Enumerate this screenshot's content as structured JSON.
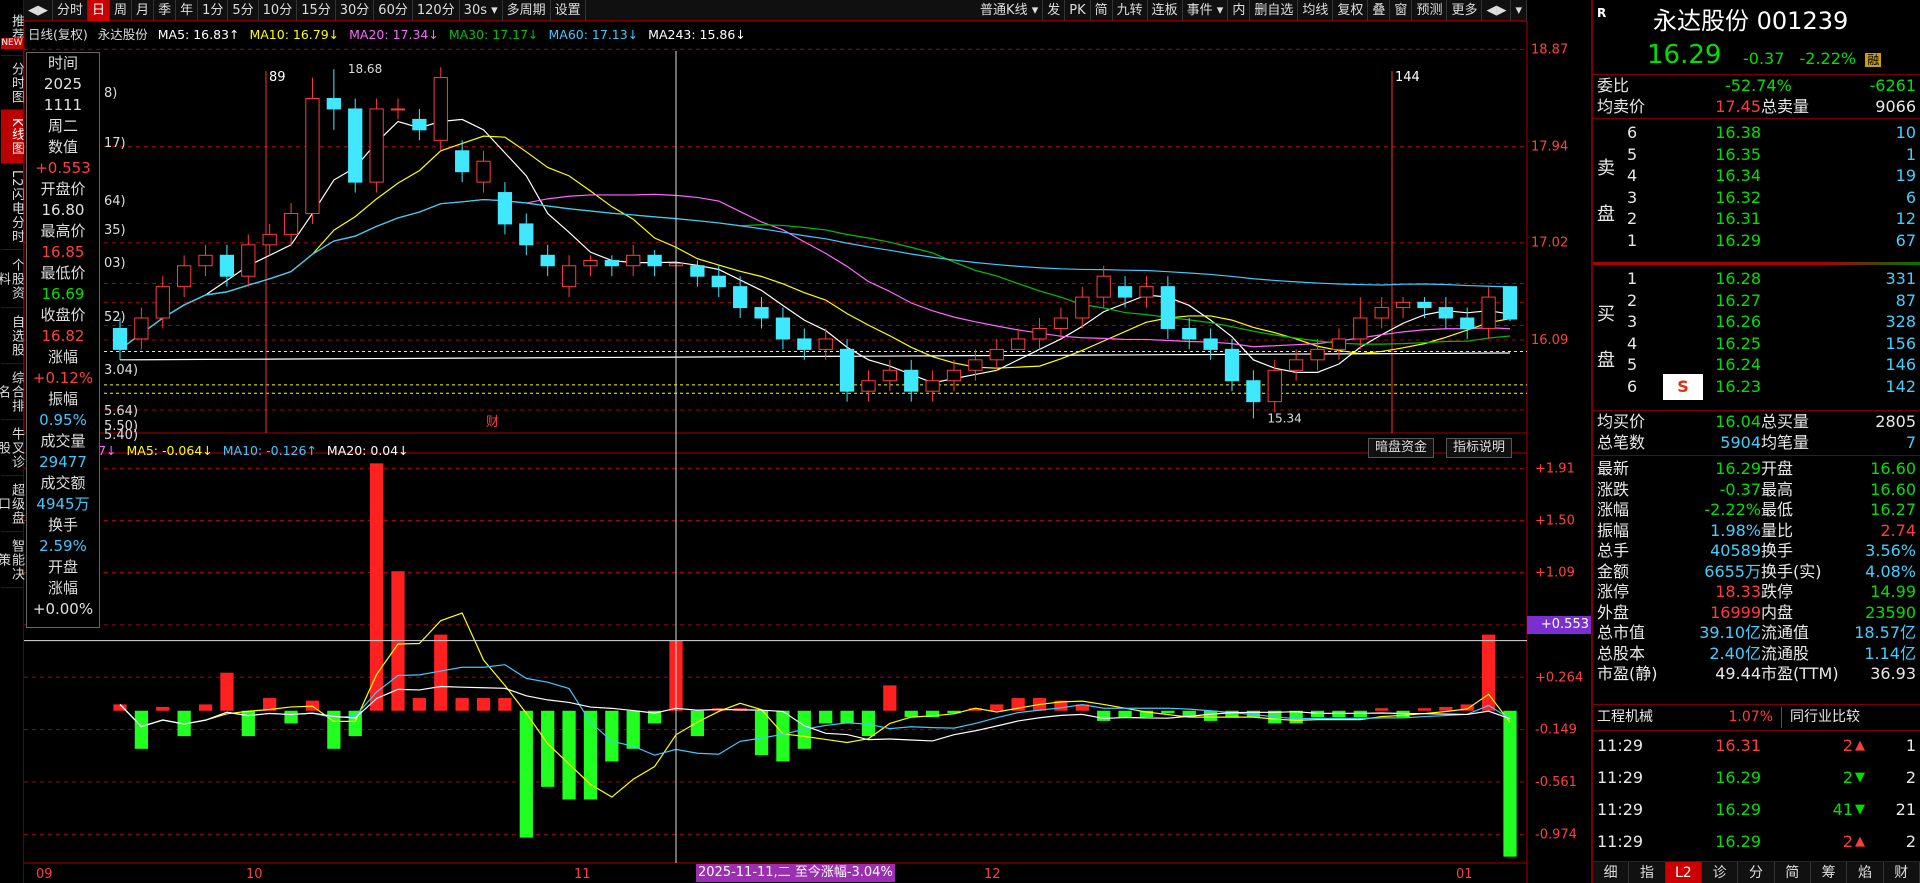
{
  "left_rail": [
    "推荐",
    "分时图",
    "K线图",
    "L2闪电分时",
    "个股资料",
    "自选股",
    "综合排名",
    "牛叉诊股",
    "超级盘口",
    "智能决策"
  ],
  "left_rail_badge": "NEW",
  "toolbar": {
    "items": [
      "◀▶",
      "分时",
      "日",
      "周",
      "月",
      "季",
      "年",
      "1分",
      "5分",
      "10分",
      "15分",
      "30分",
      "60分",
      "120分",
      "30s ▾",
      "多周期",
      "设置"
    ],
    "active_index": 2,
    "right_items": [
      "普通K线 ▾",
      "发",
      "PK",
      "简",
      "九转",
      "连板",
      "事件 ▾",
      "内",
      "删自选",
      "均线",
      "复权",
      "叠",
      "窗",
      "预测",
      "更多",
      "◀▶",
      "▾"
    ]
  },
  "legend": {
    "prefix": "日线(复权)",
    "name": "永达股份",
    "ma5": "MA5: 16.83↑",
    "ma10": "MA10: 16.79↓",
    "ma20": "MA20: 17.34↓",
    "ma30": "MA30: 17.17↓",
    "ma60": "MA60: 17.13↓",
    "ma243": "MA243: 15.86↓"
  },
  "sub_legend": {
    "net": "单净量: -0.37↓",
    "ma5": "MA5: -0.064↓",
    "ma10": "MA10: -0.126↑",
    "ma20": "MA20: 0.04↓"
  },
  "sub_buttons": [
    "暗盘资金",
    "指标说明"
  ],
  "tooltip": {
    "time_lbl": "时间",
    "year": "2025",
    "date": "1111",
    "weekday": "周二",
    "value_lbl": "数值",
    "value": "+0.553",
    "open_lbl": "开盘价",
    "open": "16.80",
    "high_lbl": "最高价",
    "high": "16.85",
    "low_lbl": "最低价",
    "low": "16.69",
    "close_lbl": "收盘价",
    "close": "16.82",
    "chg_lbl": "涨幅",
    "chg": "+0.12%",
    "amp_lbl": "振幅",
    "amp": "0.95%",
    "vol_lbl": "成交量",
    "vol": "29477",
    "amt_lbl": "成交额",
    "amt": "4945万",
    "turn_lbl": "换手",
    "turn": "2.59%",
    "openchg_lbl1": "开盘",
    "openchg_lbl2": "涨幅",
    "openchg": "+0.00%"
  },
  "price_axis": [
    "18.87",
    "17.94",
    "17.02",
    "16.09"
  ],
  "sub_axis": [
    "+1.91",
    "+1.50",
    "+1.09",
    "+0.677",
    "+0.264",
    "-0.149",
    "-0.561",
    "-0.974"
  ],
  "crosshair_value": "+0.553",
  "x_labels": [
    "09",
    "10",
    "11",
    "12",
    "01"
  ],
  "x_status": "2025-11-11,二 至今涨幅-3.04%",
  "markers": {
    "m89": "89",
    "m144": "144",
    "high": "18.68",
    "low": "15.34",
    "cai": "财"
  },
  "left_cut_labels": [
    "8)",
    "17)",
    "64)",
    "35)",
    "03)",
    "52)",
    "3.04)",
    "5.64)",
    "5.50)",
    "5.40)"
  ],
  "stock": {
    "name": "永达股份",
    "code": "001239",
    "price": "16.29",
    "change": "-0.37",
    "change_pct": "-2.22%",
    "badge": "融",
    "r_badge": "R"
  },
  "ratio": {
    "lbl": "委比",
    "pct": "-52.74%",
    "diff": "-6261"
  },
  "avg_sell": {
    "lbl": "均卖价",
    "val": "17.45",
    "tlbl": "总卖量",
    "tval": "9066"
  },
  "sell_label": [
    "卖",
    "盘"
  ],
  "sell_levels": [
    {
      "lvl": "6",
      "price": "16.38",
      "vol": "10"
    },
    {
      "lvl": "5",
      "price": "16.35",
      "vol": "1"
    },
    {
      "lvl": "4",
      "price": "16.34",
      "vol": "19"
    },
    {
      "lvl": "3",
      "price": "16.32",
      "vol": "6"
    },
    {
      "lvl": "2",
      "price": "16.31",
      "vol": "12"
    },
    {
      "lvl": "1",
      "price": "16.29",
      "vol": "67"
    }
  ],
  "buy_label": [
    "买",
    "盘"
  ],
  "buy_levels": [
    {
      "lvl": "1",
      "price": "16.28",
      "vol": "331"
    },
    {
      "lvl": "2",
      "price": "16.27",
      "vol": "87"
    },
    {
      "lvl": "3",
      "price": "16.26",
      "vol": "328"
    },
    {
      "lvl": "4",
      "price": "16.25",
      "vol": "156"
    },
    {
      "lvl": "5",
      "price": "16.24",
      "vol": "146"
    },
    {
      "lvl": "6",
      "price": "16.23",
      "vol": "142"
    }
  ],
  "avg_buy": {
    "lbl": "均买价",
    "val": "16.04",
    "tlbl": "总买量",
    "tval": "2805"
  },
  "total_trades": {
    "lbl": "总笔数",
    "val": "5904",
    "tlbl": "均笔量",
    "tval": "7"
  },
  "stats": [
    {
      "l1": "最新",
      "v1": "16.29",
      "c1": "green",
      "l2": "开盘",
      "v2": "16.60",
      "c2": "green"
    },
    {
      "l1": "涨跌",
      "v1": "-0.37",
      "c1": "green",
      "l2": "最高",
      "v2": "16.60",
      "c2": "green"
    },
    {
      "l1": "涨幅",
      "v1": "-2.22%",
      "c1": "green",
      "l2": "最低",
      "v2": "16.27",
      "c2": "green"
    },
    {
      "l1": "振幅",
      "v1": "1.98%",
      "c1": "cyan",
      "l2": "量比",
      "v2": "2.74",
      "c2": "red"
    },
    {
      "l1": "总手",
      "v1": "40589",
      "c1": "cyan",
      "l2": "换手",
      "v2": "3.56%",
      "c2": "cyan"
    },
    {
      "l1": "金额",
      "v1": "6655万",
      "c1": "cyan",
      "l2": "换手(实)",
      "v2": "4.08%",
      "c2": "cyan"
    },
    {
      "l1": "涨停",
      "v1": "18.33",
      "c1": "red",
      "l2": "跌停",
      "v2": "14.99",
      "c2": "green"
    },
    {
      "l1": "外盘",
      "v1": "16999",
      "c1": "red",
      "l2": "内盘",
      "v2": "23590",
      "c2": "green"
    },
    {
      "l1": "总市值",
      "v1": "39.10亿",
      "c1": "cyan",
      "l2": "流通值",
      "v2": "18.57亿",
      "c2": "cyan"
    },
    {
      "l1": "总股本",
      "v1": "2.40亿",
      "c1": "cyan",
      "l2": "流通股",
      "v2": "1.14亿",
      "c2": "cyan"
    },
    {
      "l1": "市盈(静)",
      "v1": "49.44",
      "c1": "white",
      "l2": "市盈(TTM)",
      "v2": "36.93",
      "c2": "white"
    }
  ],
  "industry": {
    "name": "工程机械",
    "pct": "1.07%",
    "btn": "同行业比较"
  },
  "ticks": [
    {
      "t": "11:29",
      "p": "16.31",
      "v": "2",
      "d": "up",
      "n": "1"
    },
    {
      "t": "11:29",
      "p": "16.29",
      "v": "2",
      "d": "down",
      "n": "2"
    },
    {
      "t": "11:29",
      "p": "16.29",
      "v": "41",
      "d": "down",
      "n": "21"
    },
    {
      "t": "11:29",
      "p": "16.29",
      "v": "2",
      "d": "up",
      "n": "2"
    }
  ],
  "bottom_tabs": [
    "细",
    "指",
    "L2",
    "诊",
    "分",
    "简",
    "筹",
    "焰",
    "财"
  ],
  "bottom_active": 2,
  "colors": {
    "up": "#ff3c3c",
    "down": "#00e000",
    "ma5": "#ffffff",
    "ma10": "#ffff00",
    "ma20": "#ff66ff",
    "ma30": "#00c000",
    "ma60": "#40c8ff",
    "ma243": "#ffffff"
  },
  "chart_data": {
    "type": "candlestick",
    "x": [
      "09",
      "10",
      "11",
      "12",
      "01"
    ],
    "price_ylim": [
      15.2,
      18.95
    ],
    "candles": [
      [
        16.2,
        16.0,
        16.3,
        15.9
      ],
      [
        16.1,
        16.3,
        16.4,
        16.0
      ],
      [
        16.3,
        16.6,
        16.7,
        16.2
      ],
      [
        16.6,
        16.8,
        16.9,
        16.5
      ],
      [
        16.8,
        16.9,
        17.0,
        16.7
      ],
      [
        16.9,
        16.7,
        17.0,
        16.6
      ],
      [
        16.7,
        17.0,
        17.1,
        16.6
      ],
      [
        17.0,
        17.1,
        17.2,
        16.9
      ],
      [
        17.1,
        17.3,
        17.4,
        17.0
      ],
      [
        17.3,
        18.4,
        18.6,
        17.2
      ],
      [
        18.4,
        18.3,
        18.68,
        18.1
      ],
      [
        18.3,
        17.6,
        18.4,
        17.5
      ],
      [
        17.6,
        18.3,
        18.4,
        17.5
      ],
      [
        18.3,
        18.3,
        18.4,
        18.2
      ],
      [
        18.2,
        18.1,
        18.3,
        18.0
      ],
      [
        18.0,
        18.6,
        18.7,
        17.9
      ],
      [
        17.9,
        17.7,
        18.0,
        17.6
      ],
      [
        17.6,
        17.8,
        17.9,
        17.5
      ],
      [
        17.5,
        17.2,
        17.6,
        17.1
      ],
      [
        17.2,
        17.0,
        17.3,
        16.9
      ],
      [
        16.9,
        16.8,
        17.0,
        16.7
      ],
      [
        16.6,
        16.8,
        16.9,
        16.5
      ],
      [
        16.8,
        16.85,
        16.9,
        16.7
      ],
      [
        16.85,
        16.8,
        16.9,
        16.7
      ],
      [
        16.8,
        16.9,
        17.0,
        16.7
      ],
      [
        16.9,
        16.8,
        16.95,
        16.7
      ],
      [
        16.8,
        16.82,
        16.85,
        16.69
      ],
      [
        16.8,
        16.7,
        16.85,
        16.6
      ],
      [
        16.7,
        16.6,
        16.8,
        16.5
      ],
      [
        16.6,
        16.4,
        16.7,
        16.3
      ],
      [
        16.4,
        16.3,
        16.5,
        16.2
      ],
      [
        16.3,
        16.1,
        16.4,
        16.0
      ],
      [
        16.1,
        16.0,
        16.2,
        15.9
      ],
      [
        16.0,
        16.1,
        16.2,
        15.9
      ],
      [
        16.0,
        15.6,
        16.1,
        15.5
      ],
      [
        15.6,
        15.7,
        15.8,
        15.5
      ],
      [
        15.7,
        15.8,
        15.9,
        15.6
      ],
      [
        15.8,
        15.6,
        15.9,
        15.5
      ],
      [
        15.6,
        15.7,
        15.8,
        15.5
      ],
      [
        15.7,
        15.8,
        15.9,
        15.6
      ],
      [
        15.8,
        15.9,
        16.0,
        15.7
      ],
      [
        15.9,
        16.0,
        16.1,
        15.8
      ],
      [
        16.0,
        16.1,
        16.2,
        16.0
      ],
      [
        16.1,
        16.2,
        16.3,
        16.0
      ],
      [
        16.2,
        16.3,
        16.4,
        16.1
      ],
      [
        16.3,
        16.5,
        16.6,
        16.2
      ],
      [
        16.5,
        16.7,
        16.8,
        16.4
      ],
      [
        16.6,
        16.5,
        16.7,
        16.4
      ],
      [
        16.5,
        16.6,
        16.7,
        16.4
      ],
      [
        16.6,
        16.2,
        16.7,
        16.1
      ],
      [
        16.2,
        16.1,
        16.3,
        16.0
      ],
      [
        16.1,
        16.0,
        16.2,
        15.9
      ],
      [
        16.0,
        15.7,
        16.1,
        15.6
      ],
      [
        15.7,
        15.5,
        15.8,
        15.34
      ],
      [
        15.5,
        15.8,
        15.9,
        15.4
      ],
      [
        15.8,
        15.9,
        16.0,
        15.7
      ],
      [
        15.9,
        16.0,
        16.1,
        15.8
      ],
      [
        16.0,
        16.1,
        16.2,
        15.9
      ],
      [
        16.1,
        16.3,
        16.5,
        16.0
      ],
      [
        16.3,
        16.4,
        16.5,
        16.2
      ],
      [
        16.4,
        16.45,
        16.5,
        16.3
      ],
      [
        16.45,
        16.4,
        16.5,
        16.3
      ],
      [
        16.4,
        16.3,
        16.5,
        16.2
      ],
      [
        16.3,
        16.2,
        16.4,
        16.1
      ],
      [
        16.2,
        16.5,
        16.6,
        16.1
      ],
      [
        16.6,
        16.29,
        16.6,
        16.27
      ]
    ],
    "sub_ylim": [
      -1.2,
      2.0
    ],
    "sub_bars": [
      0.05,
      -0.3,
      0.03,
      -0.2,
      0.05,
      0.3,
      -0.2,
      0.1,
      -0.1,
      0.08,
      -0.3,
      -0.2,
      1.95,
      1.1,
      0.1,
      0.6,
      0.1,
      0.1,
      0.1,
      -1.0,
      -0.6,
      -0.7,
      -0.7,
      -0.4,
      -0.3,
      -0.1,
      0.553,
      -0.2,
      0.02,
      0.02,
      -0.35,
      -0.4,
      -0.3,
      -0.1,
      -0.1,
      -0.2,
      0.2,
      -0.05,
      -0.05,
      -0.02,
      0.02,
      0.05,
      0.1,
      0.1,
      0.08,
      0.05,
      -0.08,
      -0.05,
      -0.05,
      -0.02,
      -0.05,
      -0.08,
      -0.05,
      -0.05,
      -0.1,
      -0.1,
      -0.05,
      -0.05,
      -0.05,
      0.02,
      -0.05,
      0.02,
      0.03,
      0.05,
      0.6,
      -1.15
    ]
  }
}
